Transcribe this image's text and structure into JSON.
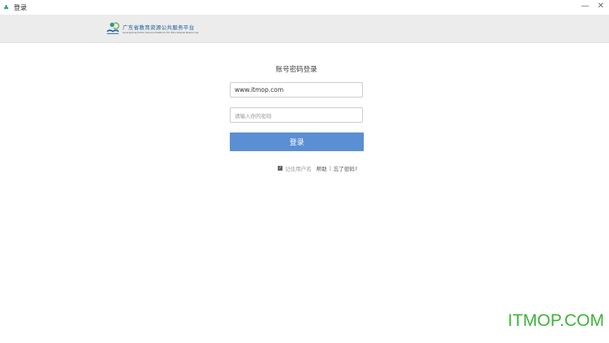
{
  "window": {
    "title": "登录",
    "minimize": "—",
    "close": "✕"
  },
  "logo": {
    "cn": "广东省教育资源公共服务平台",
    "en": "Guangdong Public Service Platform For Educational Resources"
  },
  "login": {
    "heading": "账号密码登录",
    "username_value": "www.itmop.com",
    "password_placeholder": "请输入你的密码",
    "submit": "登录",
    "remember": "记住用户名",
    "help": "帮助",
    "separator": "|",
    "forgot": "忘了密码?"
  },
  "watermark": "ITMOP.COM"
}
